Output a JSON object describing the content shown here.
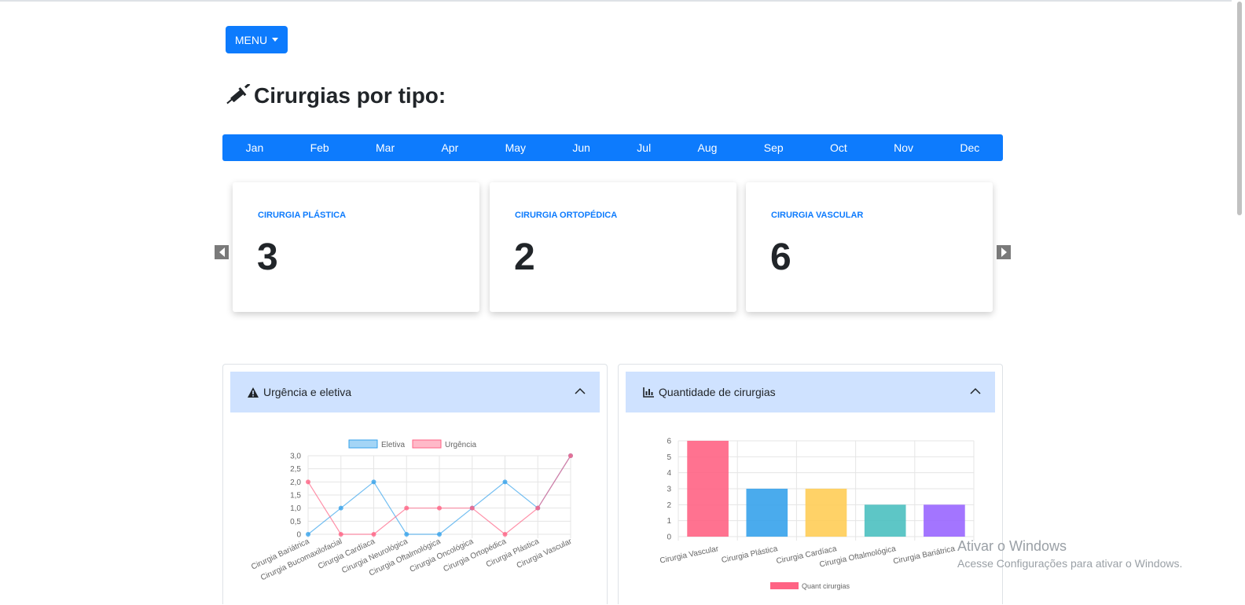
{
  "menu": {
    "label": "MENU"
  },
  "page": {
    "title": "Cirurgias por tipo:"
  },
  "months": [
    "Jan",
    "Feb",
    "Mar",
    "Apr",
    "May",
    "Jun",
    "Jul",
    "Aug",
    "Sep",
    "Oct",
    "Nov",
    "Dec"
  ],
  "cards": [
    {
      "label": "CIRURGIA PLÁSTICA",
      "value": "3"
    },
    {
      "label": "CIRURGIA ORTOPÉDICA",
      "value": "2"
    },
    {
      "label": "CIRURGIA VASCULAR",
      "value": "6"
    }
  ],
  "panels": {
    "urgencia": {
      "title": "Urgência e eletiva",
      "icon": "warning-triangle-icon"
    },
    "quantidade": {
      "title": "Quantidade de cirurgias",
      "icon": "bar-chart-icon"
    }
  },
  "chart_data": [
    {
      "type": "line",
      "categories": [
        "Cirurgia Bariátrica",
        "Cirurgia Bucomaxilofacial",
        "Cirurgia Cardíaca",
        "Cirurgia Neurológica",
        "Cirurgia Oftalmológica",
        "Cirurgia Oncológica",
        "Cirurgia Ortopédica",
        "Cirurgia Plástica",
        "Cirurgia Vascular"
      ],
      "series": [
        {
          "name": "Eletiva",
          "values": [
            0,
            1,
            2,
            0,
            0,
            1,
            2,
            1,
            3
          ],
          "color": "#36a2eb"
        },
        {
          "name": "Urgência",
          "values": [
            2,
            0,
            0,
            1,
            1,
            1,
            0,
            1,
            3
          ],
          "color": "#ff6384"
        }
      ],
      "yticks": [
        "0",
        "0,5",
        "1,0",
        "1,5",
        "2,0",
        "2,5",
        "3,0"
      ],
      "ylim": [
        0,
        3
      ],
      "grid": true,
      "legend": "top"
    },
    {
      "type": "bar",
      "categories": [
        "Cirurgia Vascular",
        "Cirurgia Plástica",
        "Cirurgia Cardíaca",
        "Cirurgia Oftalmológica",
        "Cirurgia Bariátrica"
      ],
      "series": [
        {
          "name": "Quant cirurgias",
          "values": [
            6,
            3,
            3,
            2,
            2
          ]
        }
      ],
      "colors": [
        "#ff6384",
        "#36a2eb",
        "#ffcd56",
        "#4bc0c0",
        "#9966ff"
      ],
      "yticks": [
        "0",
        "1",
        "2",
        "3",
        "4",
        "5",
        "6"
      ],
      "ylim": [
        0,
        6
      ],
      "grid": true,
      "legend": "bottom"
    }
  ],
  "watermark": {
    "title": "Ativar o Windows",
    "subtitle": "Acesse Configurações para ativar o Windows."
  }
}
